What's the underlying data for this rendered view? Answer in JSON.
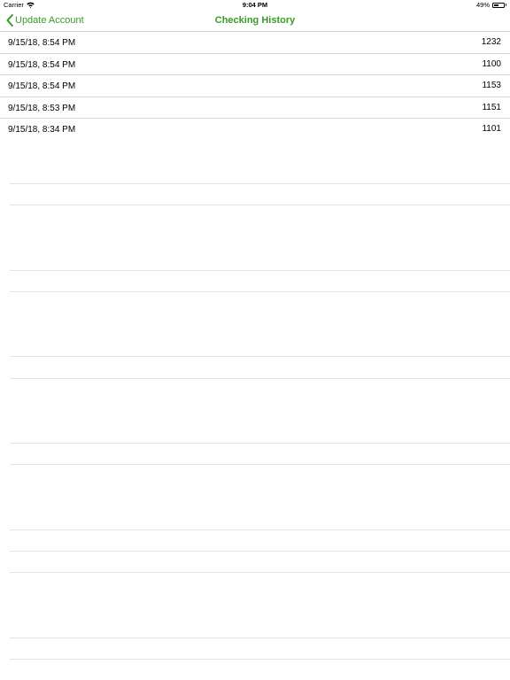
{
  "status_bar": {
    "carrier": "Carrier",
    "time": "9:04 PM",
    "battery_percent": "49%",
    "battery_level": 0.49
  },
  "nav": {
    "back_label": "Update Account",
    "title": "Checking History",
    "accent_color": "#3a9a2a"
  },
  "history": [
    {
      "date": "9/15/18, 8:54 PM",
      "value": "1232"
    },
    {
      "date": "9/15/18, 8:54 PM",
      "value": "1100"
    },
    {
      "date": "9/15/18, 8:54 PM",
      "value": "1153"
    },
    {
      "date": "9/15/18, 8:53 PM",
      "value": "1151"
    },
    {
      "date": "9/15/18, 8:34 PM",
      "value": "1101"
    }
  ]
}
